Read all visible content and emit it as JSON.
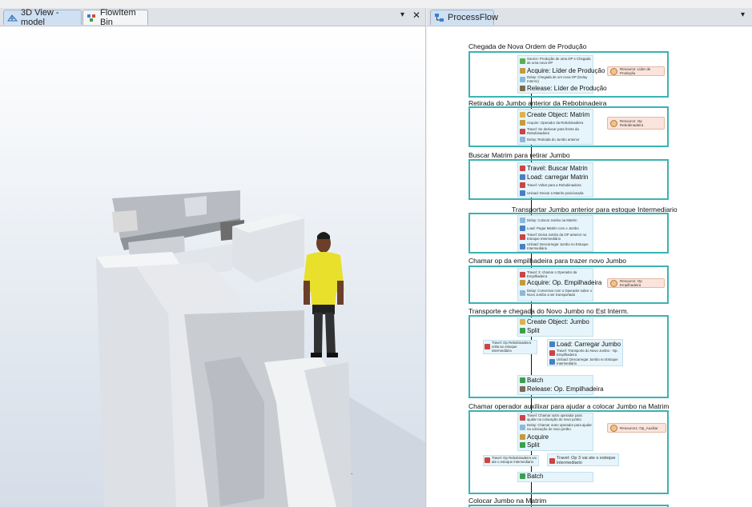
{
  "left_tabs": [
    {
      "label": "3D View - model",
      "icon": "grid-3d-icon"
    },
    {
      "label": "FlowItem Bin",
      "icon": "flowitem-bin-icon"
    }
  ],
  "right_tabs": [
    {
      "label": "ProcessFlow",
      "icon": "processflow-icon"
    }
  ],
  "pin_glyph": "▾",
  "close_glyph": "✕",
  "sections": [
    {
      "title": "Chegada de Nova Ordem de Produção"
    },
    {
      "title": "Retirada do Jumbo anterior da Rebobinadeira"
    },
    {
      "title": "Buscar Matrim para retirar Jumbo"
    },
    {
      "title": "Transportar Jumbo anterior  para estoque Intermediario"
    },
    {
      "title": "Chamar op da empilhadeira para trazer novo Jumbo"
    },
    {
      "title": "Transporte e chegada do Novo Jumbo no Est Interm."
    },
    {
      "title": "Chamar operador auxilixar para ajudar a colocar Jumbo na Matrim"
    },
    {
      "title": "Colocar Jumbo na Matrim"
    }
  ],
  "activities": {
    "s1": [
      "Source: Produção de uma OP e Chegada de uma nova OP",
      "Acquire: Líder de Produção",
      "Delay: Chegada de um nova OP (Delay Interno)",
      "Release: Líder de Produção"
    ],
    "s1_res": "Resource: Líder de Produção",
    "s2": [
      "Create Object: Matrim",
      "Acquire: Operador da Rebobinadeira",
      "Travel: Se deslocar para frente da Rebobinadeira",
      "Delay: Retirada do Jumbo anterior"
    ],
    "s2_res": "Resource: Op Rebobinadeira",
    "s3": [
      "Travel: Buscar Matrin",
      "Load: carregar Matrin",
      "Travel: Voltar para a Rebobinadeira",
      "Unload: Deixar a Matrim posicionada"
    ],
    "s4": [
      "Delay: Colocar Jumbo na Matrim",
      "Load: Pegar Matrim com o Jumbo",
      "Travel: Deixa Jumbo da OP anterior no Estoque Intermediário",
      "Unload: Descarregar Jumbo no Estoque Intermediário"
    ],
    "s5": [
      "Travel: 3: chamar o Operador da Empilhadeira",
      "Acquire: Op. Empilhadeira",
      "Delay: Conversar com o Operador sobre o Novo Jumbo a ser transportado"
    ],
    "s5_res": "Resource: Op Empilhadeira",
    "s6": [
      "Create Object: Jumbo",
      "Split",
      "Travel: Op Rebobinadeira volta ao estoque intermediário",
      "Load: Carregar Jumbo",
      "Travel: Transporte do Novo Jumbo - Op. Empilhadeira",
      "Unload: Descarregar Jumbo no Estoque Intermediário",
      "Batch",
      "Release: Op. Empilhadeira"
    ],
    "s7": [
      "Travel: Chamar outro operador para ajudar na colocação do novo jumbo",
      "Delay: Chamar outro operador para ajudar na colocação do novo jumbo",
      "Acquire",
      "Split",
      "Travel: Op Rebobinadeira vai ate o estoque intermediario",
      "Travel: Op 3 vai ate o estoque intermediario",
      "Batch"
    ],
    "s7_res": "Resource1: Op_Auxiliar"
  },
  "colors": {
    "accent": "#3bb3b3",
    "inner": "#e6f5fb",
    "resource": "#fbe4dc",
    "active_tab": "#cfe0f3",
    "shirt": "#e8e02a"
  }
}
